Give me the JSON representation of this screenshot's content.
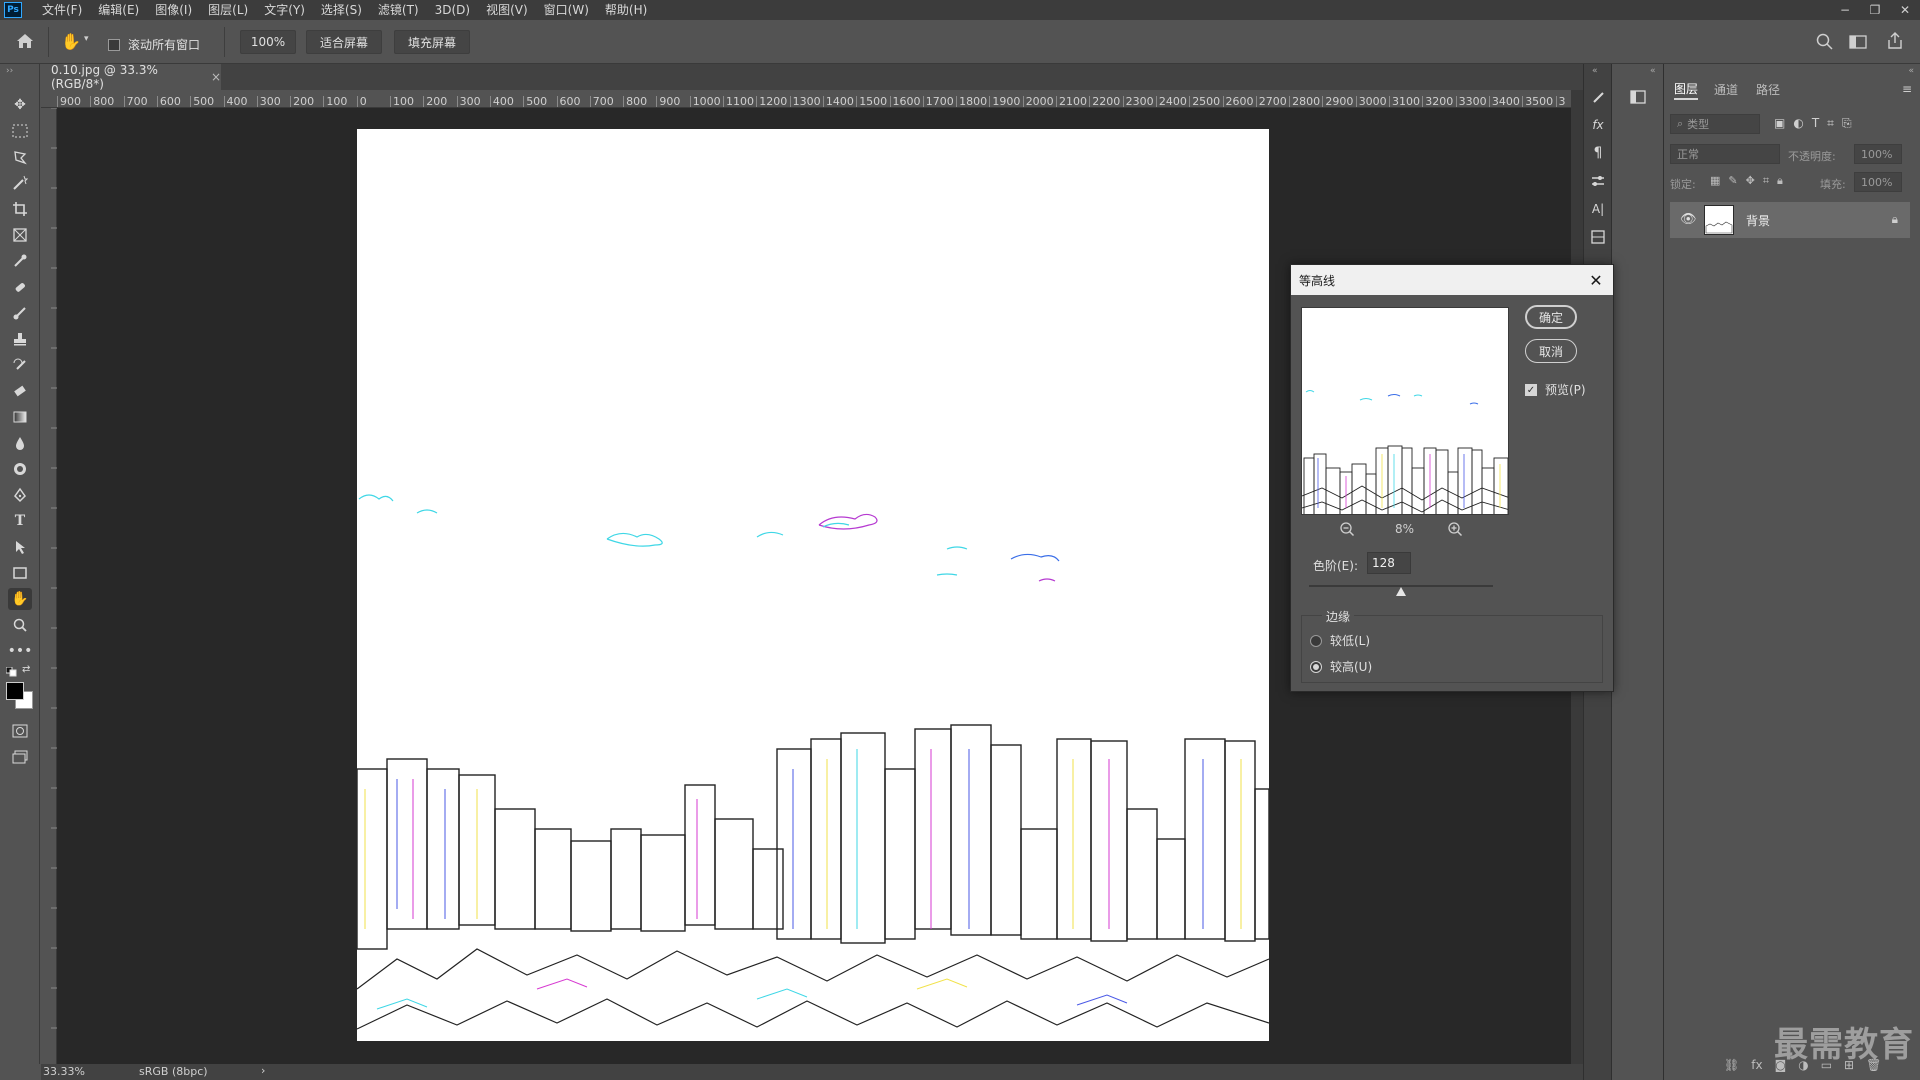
{
  "menubar": {
    "logo": "Ps",
    "items": [
      "文件(F)",
      "编辑(E)",
      "图像(I)",
      "图层(L)",
      "文字(Y)",
      "选择(S)",
      "滤镜(T)",
      "3D(D)",
      "视图(V)",
      "窗口(W)",
      "帮助(H)"
    ],
    "win_min": "−",
    "win_restore": "❐",
    "win_close": "✕"
  },
  "options": {
    "scroll_all_label": "滚动所有窗口",
    "scroll_all_checked": false,
    "zoom_btn": "100%",
    "fit_btn": "适合屏幕",
    "fill_btn": "填充屏幕"
  },
  "document": {
    "tab_title": "0.10.jpg @ 33.3%(RGB/8*)",
    "tab_close": "×",
    "ruler_labels": [
      "900",
      "800",
      "700",
      "600",
      "500",
      "400",
      "300",
      "200",
      "100",
      "0",
      "100",
      "200",
      "300",
      "400",
      "500",
      "600",
      "700",
      "800",
      "900",
      "1000",
      "1100",
      "1200",
      "1300",
      "1400",
      "1500",
      "1600",
      "1700",
      "1800",
      "1900",
      "2000",
      "2100",
      "2200",
      "2300",
      "2400",
      "2500",
      "2600",
      "2700",
      "2800",
      "2900",
      "3000",
      "3100",
      "3200",
      "3300",
      "3400",
      "3500",
      "3"
    ]
  },
  "status": {
    "zoom": "33.33%",
    "profile": "sRGB (8bpc)",
    "arrow": "›"
  },
  "layers_panel": {
    "tabs": [
      "图层",
      "通道",
      "路径"
    ],
    "search_placeholder": "类型",
    "blend_mode": "正常",
    "opacity_label": "不透明度:",
    "opacity_value": "100%",
    "lock_label": "锁定:",
    "fill_label": "填充:",
    "fill_value": "100%",
    "layer_name": "背景"
  },
  "dialog": {
    "title": "等高线",
    "ok": "确定",
    "cancel": "取消",
    "preview_label": "预览(P)",
    "preview_checked": true,
    "zoom_percent": "8%",
    "level_label": "色阶(E):",
    "level_value": "128",
    "edge_group_title": "边缘",
    "edge_lower": "较低(L)",
    "edge_upper": "较高(U)",
    "edge_selected": "upper"
  },
  "watermark": "最需教育"
}
